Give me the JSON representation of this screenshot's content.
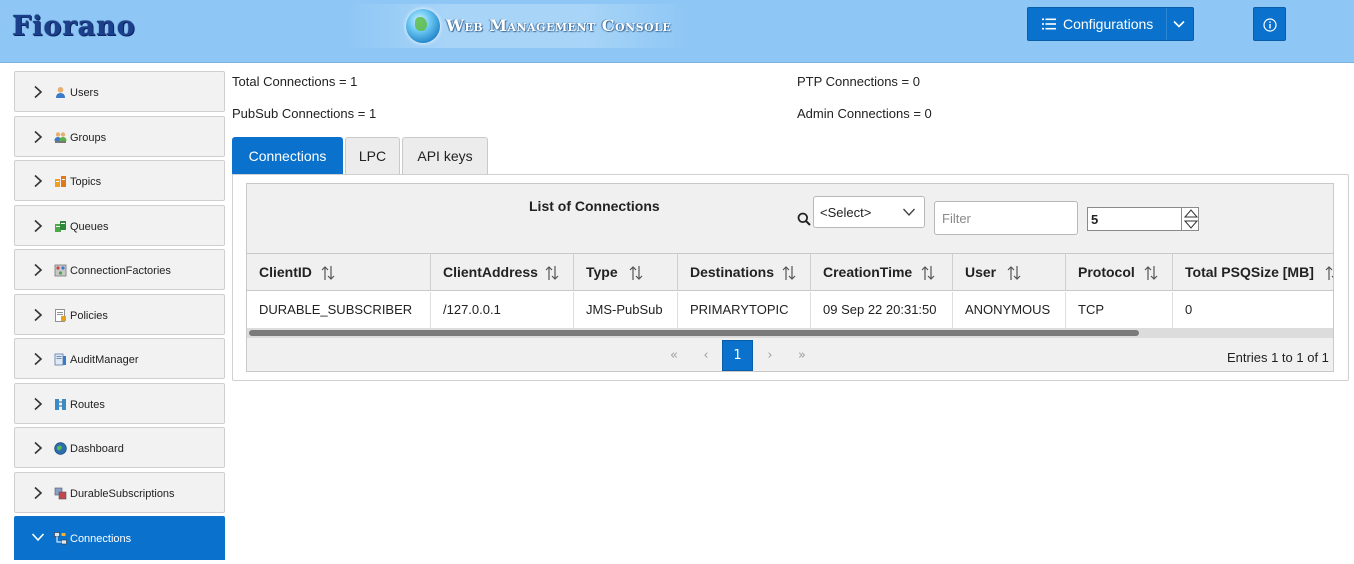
{
  "header": {
    "logo": "Fiorano",
    "console_title": "Web Management Console",
    "configurations_label": "Configurations"
  },
  "sidebar": {
    "items": [
      {
        "label": "Users",
        "icon": "user-icon"
      },
      {
        "label": "Groups",
        "icon": "groups-icon"
      },
      {
        "label": "Topics",
        "icon": "topics-icon"
      },
      {
        "label": "Queues",
        "icon": "queues-icon"
      },
      {
        "label": "ConnectionFactories",
        "icon": "connection-factories-icon"
      },
      {
        "label": "Policies",
        "icon": "policies-icon"
      },
      {
        "label": "AuditManager",
        "icon": "audit-manager-icon"
      },
      {
        "label": "Routes",
        "icon": "routes-icon"
      },
      {
        "label": "Dashboard",
        "icon": "dashboard-icon"
      },
      {
        "label": "DurableSubscriptions",
        "icon": "durable-subscriptions-icon"
      },
      {
        "label": "Connections",
        "icon": "connections-icon",
        "active": true
      }
    ]
  },
  "stats": {
    "total": "Total Connections = 1",
    "pubsub": "PubSub Connections = 1",
    "ptp": "PTP Connections = 0",
    "admin": "Admin Connections = 0"
  },
  "tabs": [
    {
      "label": "Connections",
      "active": true
    },
    {
      "label": "LPC"
    },
    {
      "label": "API keys"
    }
  ],
  "table": {
    "title": "List of Connections",
    "select_value": "<Select>",
    "filter_placeholder": "Filter",
    "rows_per_page": "5",
    "columns": [
      "ClientID",
      "ClientAddress",
      "Type",
      "Destinations",
      "CreationTime",
      "User",
      "Protocol",
      "Total PSQSize [MB]"
    ],
    "rows": [
      [
        "DURABLE_SUBSCRIBER",
        "/127.0.0.1",
        "JMS-PubSub",
        "PRIMARYTOPIC",
        "09 Sep 22 20:31:50",
        "ANONYMOUS",
        "TCP",
        "0"
      ]
    ],
    "pagination": {
      "first": "«",
      "prev": "‹",
      "current_page": "1",
      "next": "›",
      "last": "»",
      "entries": "Entries 1 to 1 of 1"
    }
  },
  "colors": {
    "header_bg": "#8ec7f5",
    "primary": "#0a72cc"
  }
}
